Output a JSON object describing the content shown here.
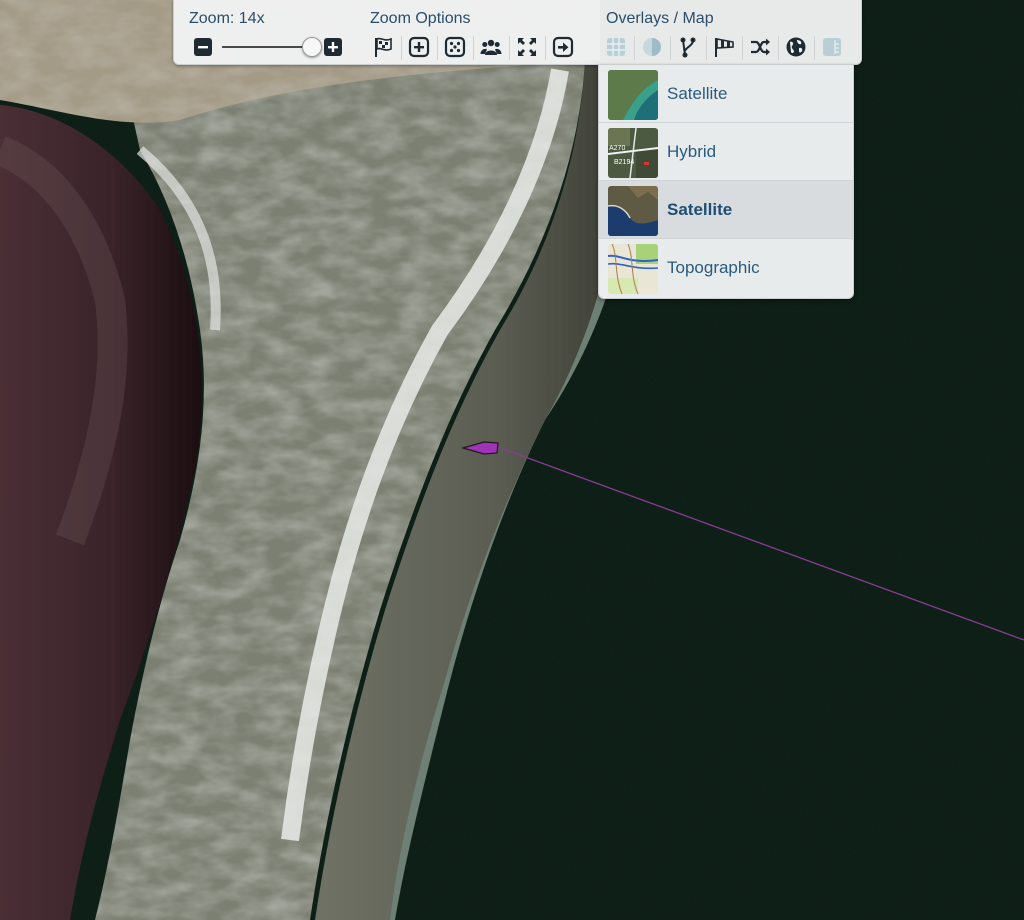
{
  "toolbar": {
    "zoom_label": "Zoom: 14x",
    "zoom_options_label": "Zoom Options",
    "overlays_label": "Overlays / Map"
  },
  "map_types": [
    {
      "label": "Satellite",
      "thumb": "satellite-coast-thumbnail",
      "selected": false
    },
    {
      "label": "Hybrid",
      "thumb": "hybrid-map-thumbnail",
      "selected": false
    },
    {
      "label": "Satellite",
      "thumb": "satellite-bay-thumbnail",
      "selected": true
    },
    {
      "label": "Topographic",
      "thumb": "topographic-thumbnail",
      "selected": false
    }
  ],
  "hybrid_thumb_labels": [
    "A270",
    "B2194"
  ],
  "colors": {
    "route_line": "#8a3c96",
    "boat_marker": "#a034b8",
    "ui_text": "#2a4e6a",
    "sea": "#0f2219",
    "lagoon": "#3a2429"
  },
  "icons": [
    "zoom-out-icon",
    "zoom-in-icon",
    "flag-icon",
    "zoom-in-square-icon",
    "dice-icon",
    "group-icon",
    "fit-expand-icon",
    "exit-arrow-icon",
    "grid-icon",
    "contrast-icon",
    "fork-icon",
    "wind-flag-icon",
    "shuffle-icon",
    "globe-icon",
    "map-layer-icon"
  ]
}
